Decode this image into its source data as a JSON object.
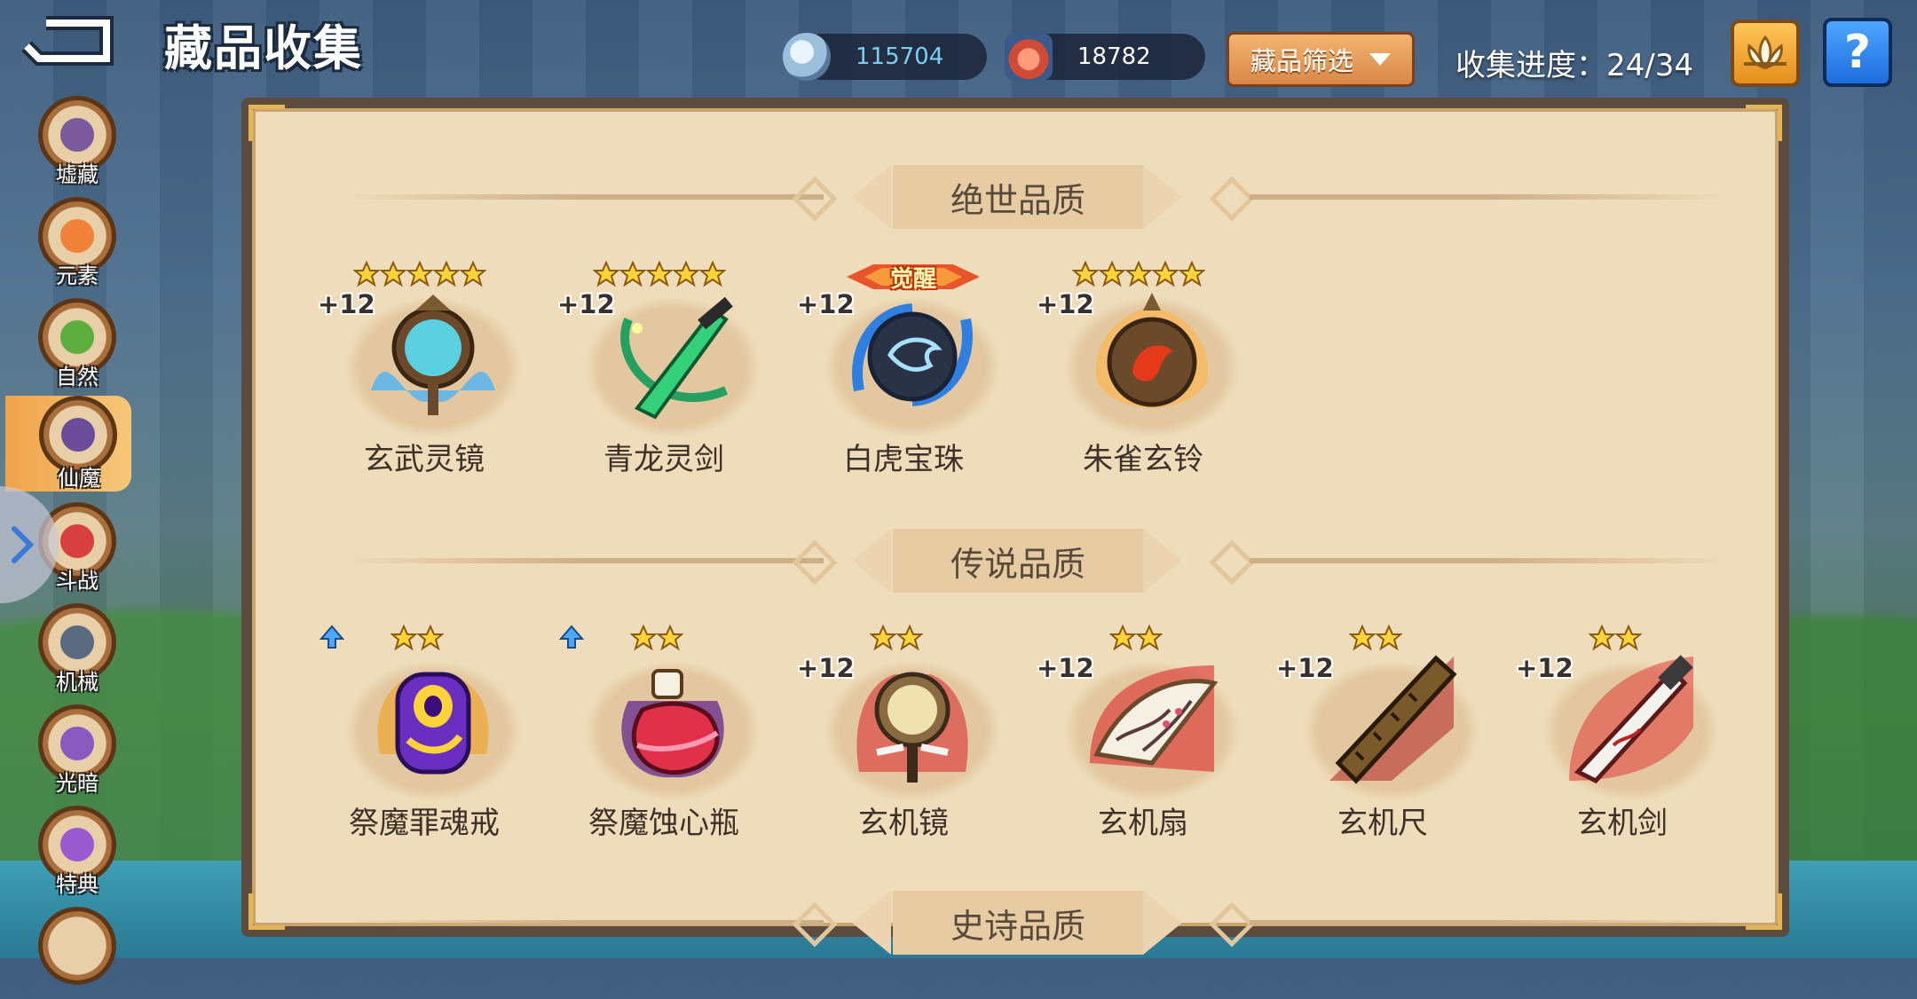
{
  "header": {
    "title": "藏品收集",
    "filter_label": "藏品筛选",
    "progress_text": "收集进度：24/34",
    "help_label": "?"
  },
  "resources": [
    {
      "name": "silver-coin",
      "value": "115704",
      "color": "#7ccff0"
    },
    {
      "name": "red-gem",
      "value": "18782",
      "color": "#ffffff"
    }
  ],
  "sidebar": {
    "items": [
      {
        "label": "墟藏",
        "color": "#7a5a9a"
      },
      {
        "label": "元素",
        "color": "#f0823a"
      },
      {
        "label": "自然",
        "color": "#5cae3e"
      },
      {
        "label": "仙魔",
        "color": "#6a4c9a",
        "active": true
      },
      {
        "label": "斗战",
        "color": "#d84040"
      },
      {
        "label": "机械",
        "color": "#5a6a80"
      },
      {
        "label": "光暗",
        "color": "#8a5ac0"
      },
      {
        "label": "特典",
        "color": "#9a5ad0"
      }
    ]
  },
  "sections": [
    {
      "title": "绝世品质",
      "items": [
        {
          "name": "玄武灵镜",
          "level": "+12",
          "stars": 5,
          "color": "#3bb0ff"
        },
        {
          "name": "青龙灵剑",
          "level": "+12",
          "stars": 5,
          "color": "#2fd07a"
        },
        {
          "name": "白虎宝珠",
          "level": "+12",
          "badge": "觉醒",
          "color": "#2f7fe0"
        },
        {
          "name": "朱雀玄铃",
          "level": "+12",
          "stars": 5,
          "color": "#ff7a1c"
        }
      ]
    },
    {
      "title": "传说品质",
      "items": [
        {
          "name": "祭魔罪魂戒",
          "stars": 2,
          "upgrade": true,
          "color": "#7a3fd0"
        },
        {
          "name": "祭魔蚀心瓶",
          "stars": 2,
          "upgrade": true,
          "color": "#e0304a"
        },
        {
          "name": "玄机镜",
          "level": "+12",
          "stars": 2,
          "color": "#d8a850"
        },
        {
          "name": "玄机扇",
          "level": "+12",
          "stars": 2,
          "color": "#d82c2c"
        },
        {
          "name": "玄机尺",
          "level": "+12",
          "stars": 2,
          "color": "#b22222"
        },
        {
          "name": "玄机剑",
          "level": "+12",
          "stars": 2,
          "color": "#e23a3a"
        }
      ]
    },
    {
      "title": "史诗品质",
      "items": []
    }
  ]
}
